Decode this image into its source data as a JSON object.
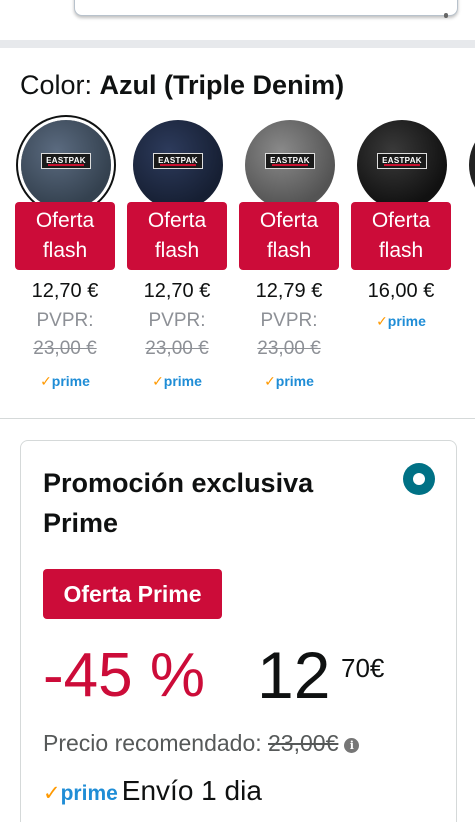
{
  "color_selector": {
    "label": "Color:",
    "selected_value": "Azul (Triple Denim)"
  },
  "swatches": [
    {
      "name": "Azul (Triple Denim)",
      "selected": true,
      "swatch_color": "#3b4a5e",
      "brand": "EASTPAK",
      "deal_label": "Oferta flash",
      "price": "12,70 €",
      "rrp_label": "PVPR:",
      "rrp": "23,00 €",
      "prime": "prime"
    },
    {
      "name": "Navy",
      "selected": false,
      "swatch_color": "#1f2a44",
      "brand": "EASTPAK",
      "deal_label": "Oferta flash",
      "price": "12,70 €",
      "rrp_label": "PVPR:",
      "rrp": "23,00 €",
      "prime": "prime"
    },
    {
      "name": "Grey",
      "selected": false,
      "swatch_color": "#6e6e6e",
      "brand": "EASTPAK",
      "deal_label": "Oferta flash",
      "price": "12,79 €",
      "rrp_label": "PVPR:",
      "rrp": "23,00 €",
      "prime": "prime"
    },
    {
      "name": "Black",
      "selected": false,
      "swatch_color": "#1e1e1e",
      "brand": "EASTPAK",
      "deal_label": "Oferta flash",
      "price": "16,00 €",
      "rrp_label": "",
      "rrp": "",
      "prime": "prime"
    }
  ],
  "promo": {
    "title": "Promoción exclusiva Prime",
    "badge": "Oferta Prime",
    "discount": "-45 %",
    "price_whole": "12",
    "price_fraction": "70€",
    "rrp_label": "Precio recomendado:",
    "rrp_value": "23,00€",
    "prime_logo": "prime",
    "shipping": "Envío 1 dia"
  },
  "colors": {
    "deal_red": "#cc0c39",
    "prime_blue": "#1f8dd6",
    "prime_check": "#ff9900",
    "radio_teal": "#007185",
    "muted_text": "#8d9096"
  },
  "icons": {
    "info": "info-icon",
    "radio": "radio-selected-icon",
    "prime_check": "check-icon"
  }
}
